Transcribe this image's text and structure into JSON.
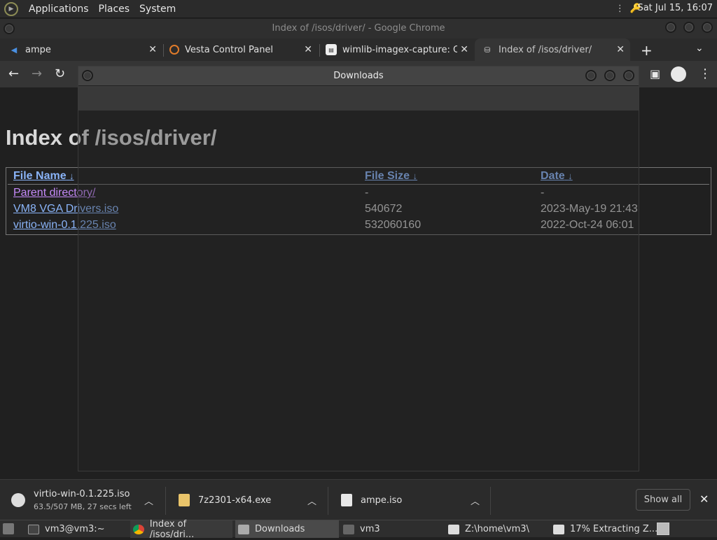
{
  "top_panel": {
    "menus": [
      "Applications",
      "Places",
      "System"
    ],
    "clock": "Sat Jul 15, 16:07"
  },
  "chrome": {
    "window_title": "Index of /isos/driver/ - Google Chrome",
    "tabs": [
      {
        "label": "ampe"
      },
      {
        "label": "Vesta Control Panel"
      },
      {
        "label": "wimlib-imagex-capture: Cr"
      },
      {
        "label": "Index of /isos/driver/"
      }
    ]
  },
  "page": {
    "title": "Index of /isos/driver/",
    "headers": {
      "name": "File Name",
      "size": "File Size",
      "date": "Date",
      "sort_arrow": "↓"
    },
    "rows": [
      {
        "name": "Parent directory/",
        "size": "-",
        "date": "-"
      },
      {
        "name": "VM8 VGA Drivers.iso",
        "size": "540672",
        "date": "2023-May-19 21:43"
      },
      {
        "name": "virtio-win-0.1.225.iso",
        "size": "532060160",
        "date": "2022-Oct-24 06:01"
      }
    ]
  },
  "downloads_dialog": {
    "title": "Downloads"
  },
  "download_bar": {
    "items": [
      {
        "filename": "virtio-win-0.1.225.iso",
        "status": "63.5/507 MB, 27 secs left"
      },
      {
        "filename": "7z2301-x64.exe"
      },
      {
        "filename": "ampe.iso"
      }
    ],
    "show_all": "Show all"
  },
  "taskbar": {
    "tasks": [
      {
        "label": "vm3@vm3:~"
      },
      {
        "label": "Index of /isos/dri..."
      },
      {
        "label": "Downloads"
      },
      {
        "label": "vm3"
      },
      {
        "label": "Z:\\home\\vm3\\"
      },
      {
        "label": "17% Extracting Z..."
      }
    ]
  }
}
